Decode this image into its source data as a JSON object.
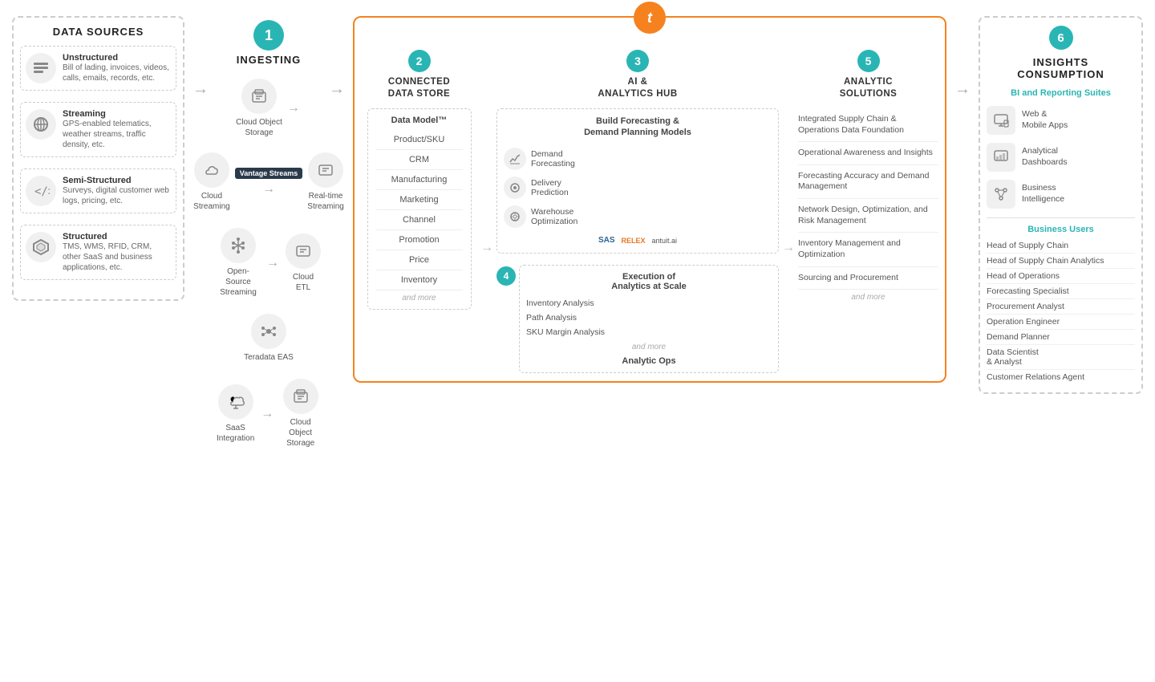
{
  "dataSources": {
    "title": "DATA SOURCES",
    "items": [
      {
        "id": "unstructured",
        "title": "Unstructured",
        "desc": "Bill of lading, invoices, videos, calls, emails, records, etc.",
        "icon": "≡"
      },
      {
        "id": "streaming",
        "title": "Streaming",
        "desc": "GPS-enabled telematics, weather streams, traffic density, etc.",
        "icon": "⊕"
      },
      {
        "id": "semi-structured",
        "title": "Semi-Structured",
        "desc": "Surveys, digital customer web logs, pricing, etc.",
        "icon": "<>"
      },
      {
        "id": "structured",
        "title": "Structured",
        "desc": "TMS, WMS, RFID, CRM, other SaaS and business applications, etc.",
        "icon": "⬡"
      }
    ]
  },
  "ingesting": {
    "stepNum": "1",
    "title": "INGESTING",
    "items": [
      {
        "id": "cloud-object-storage-1",
        "label": "Cloud Object\nStorage",
        "icon": "🗄"
      },
      {
        "id": "cloud-streaming",
        "label": "Cloud\nStreaming",
        "icon": "☁"
      },
      {
        "id": "realtime-streaming",
        "label": "Real-time\nStreaming",
        "icon": "🗄"
      },
      {
        "id": "open-source-streaming",
        "label": "Open-Source\nStreaming",
        "icon": "⬦"
      },
      {
        "id": "cloud-etl",
        "label": "Cloud\nETL",
        "icon": "🗄"
      },
      {
        "id": "teradata-eas",
        "label": "Teradata EAS",
        "icon": "✦"
      },
      {
        "id": "saas-integration",
        "label": "SaaS\nIntegration",
        "icon": "∞"
      },
      {
        "id": "cloud-object-storage-2",
        "label": "Cloud Object\nStorage",
        "icon": "🗄"
      }
    ],
    "vantageBadge": "Vantage\nStreams"
  },
  "connectedDataStore": {
    "stepNum": "2",
    "title": "CONNECTED\nDATA STORE",
    "dataModelLabel": "Data Model™",
    "items": [
      "Product/SKU",
      "CRM",
      "Manufacturing",
      "Marketing",
      "Channel",
      "Promotion",
      "Price",
      "Inventory"
    ],
    "andMore": "and more"
  },
  "aiAnalyticsHub": {
    "stepNum": "3",
    "title": "AI &\nANALYTICS HUB",
    "buildTitle": "Build Forecasting &\nDemand Planning Models",
    "models": [
      {
        "id": "demand-forecasting",
        "label": "Demand\nForecasting",
        "icon": "📈"
      },
      {
        "id": "delivery-prediction",
        "label": "Delivery\nPrediction",
        "icon": "🔍"
      },
      {
        "id": "warehouse-optimization",
        "label": "Warehouse\nOptimization",
        "icon": "⚙"
      }
    ],
    "partners": [
      "SAS",
      "RELEX",
      "antuit.ai"
    ],
    "executionStepNum": "4",
    "executionTitle": "Execution of\nAnalytics at Scale",
    "executionItems": [
      "Inventory Analysis",
      "Path Analysis",
      "SKU Margin Analysis"
    ],
    "andMore": "and more",
    "analyticOpsLabel": "Analytic Ops"
  },
  "analyticSolutions": {
    "stepNum": "5",
    "title": "ANALYTIC\nSOLUTIONS",
    "items": [
      "Integrated Supply Chain & Operations Data Foundation",
      "Operational Awareness and Insights",
      "Forecasting Accuracy and Demand Management",
      "Network Design, Optimization, and Risk Management",
      "Inventory Management and Optimization",
      "Sourcing and Procurement"
    ],
    "andMore": "and more"
  },
  "insightsConsumption": {
    "stepNum": "6",
    "title": "INSIGHTS\nCONSUMPTION",
    "biTitle": "BI and\nReporting Suites",
    "biItems": [
      {
        "id": "web-mobile",
        "label": "Web &\nMobile Apps",
        "icon": "🖥"
      },
      {
        "id": "analytical-dashboards",
        "label": "Analytical\nDashboards",
        "icon": "📊"
      },
      {
        "id": "business-intelligence",
        "label": "Business\nIntelligence",
        "icon": "🔗"
      }
    ],
    "businessUsersTitle": "Business Users",
    "businessUsers": [
      "Head of Supply Chain",
      "Head of Supply Chain Analytics",
      "Head of Operations",
      "Forecasting Specialist",
      "Procurement Analyst",
      "Operation Engineer",
      "Demand Planner",
      "Data Scientist\n& Analyst",
      "Customer Relations Agent"
    ]
  }
}
